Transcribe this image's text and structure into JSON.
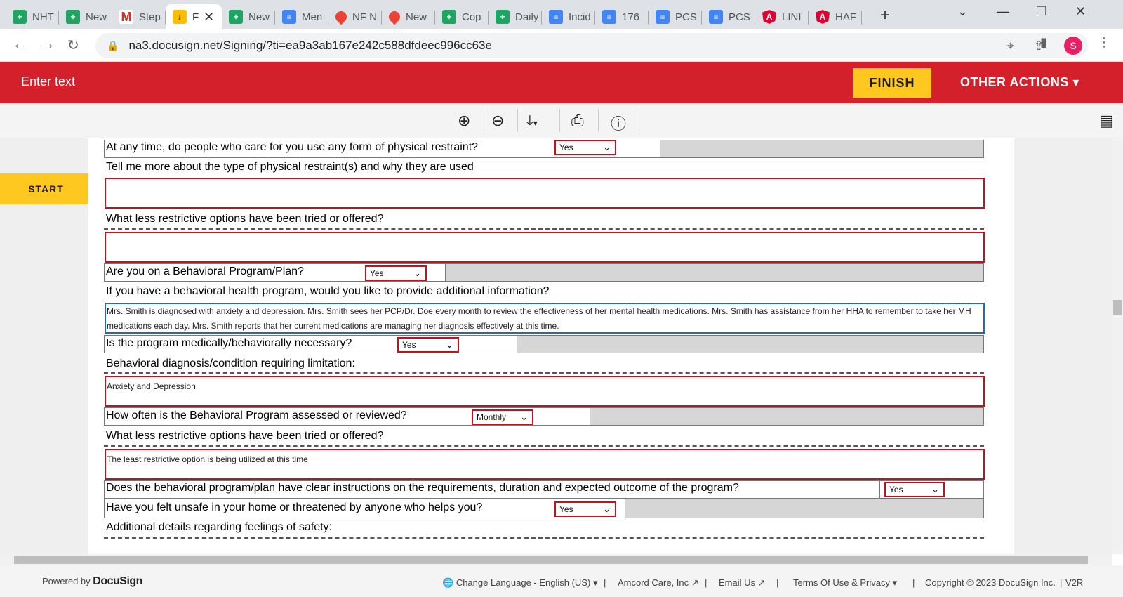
{
  "browser": {
    "tabs": [
      {
        "label": "NHT",
        "icon": "sheets"
      },
      {
        "label": "New",
        "icon": "sheets"
      },
      {
        "label": "Step",
        "icon": "gmail"
      },
      {
        "label": "F",
        "icon": "download",
        "active": true
      },
      {
        "label": "New",
        "icon": "sheets"
      },
      {
        "label": "Men",
        "icon": "docs"
      },
      {
        "label": "NF N",
        "icon": "maps"
      },
      {
        "label": "New",
        "icon": "maps"
      },
      {
        "label": "Cop",
        "icon": "sheets"
      },
      {
        "label": "Daily",
        "icon": "sheets"
      },
      {
        "label": "Incid",
        "icon": "docs"
      },
      {
        "label": "176",
        "icon": "docs"
      },
      {
        "label": "PCS",
        "icon": "docs"
      },
      {
        "label": "PCS",
        "icon": "docs"
      },
      {
        "label": "LINI",
        "icon": "angular"
      },
      {
        "label": "HAF",
        "icon": "angular"
      }
    ],
    "url": "na3.docusign.net/Signing/?ti=ea9a3ab167e242c588dfdeec996cc63e",
    "profile_initial": "S"
  },
  "header": {
    "title": "Enter text",
    "finish": "FINISH",
    "other_actions": "OTHER ACTIONS"
  },
  "sidebar": {
    "start": "START"
  },
  "form": {
    "q1": "At any time, do people who care for you use any form of physical restraint?",
    "q1_value": "Yes",
    "q2": "Tell me more about the type of physical restraint(s) and why they are used",
    "q2_value": "",
    "q3": "What less restrictive options have been tried or offered?",
    "q3_value": "",
    "q4": "Are you on a Behavioral Program/Plan?",
    "q4_value": "Yes",
    "q5": "If you have a behavioral health program, would you like to provide additional information?",
    "q5_value": "Mrs. Smith is diagnosed with anxiety and depression.  Mrs. Smith sees her PCP/Dr. Doe every month to review the effectiveness of her mental health medications.  Mrs. Smith has assistance from her HHA to remember to take her MH medications each day.  Mrs. Smith reports that her current medications are managing her diagnosis effectively at this time.",
    "q6": "Is the program medically/behaviorally necessary?",
    "q6_value": "Yes",
    "q7": "Behavioral diagnosis/condition requiring limitation:",
    "q7_value": "Anxiety and Depression",
    "q8": "How often is the Behavioral Program assessed or reviewed?",
    "q8_value": "Monthly",
    "q9": "What less restrictive options have been tried or offered?",
    "q9_value": "The least restrictive option is being utilized at this time",
    "q10": "Does the behavioral program/plan have clear instructions on the requirements, duration and expected outcome of the program?",
    "q10_value": "Yes",
    "q11": "Have you felt unsafe in your home or threatened by anyone who helps you?",
    "q11_value": "Yes",
    "q12": "Additional details regarding feelings of safety:"
  },
  "footer": {
    "powered_by": "Powered by",
    "brand": "DocuSign",
    "language": "Change Language - English (US)",
    "company": "Amcord Care, Inc",
    "email": "Email Us",
    "terms": "Terms Of Use & Privacy",
    "copyright": "Copyright © 2023 DocuSign Inc.",
    "version": "V2R"
  }
}
